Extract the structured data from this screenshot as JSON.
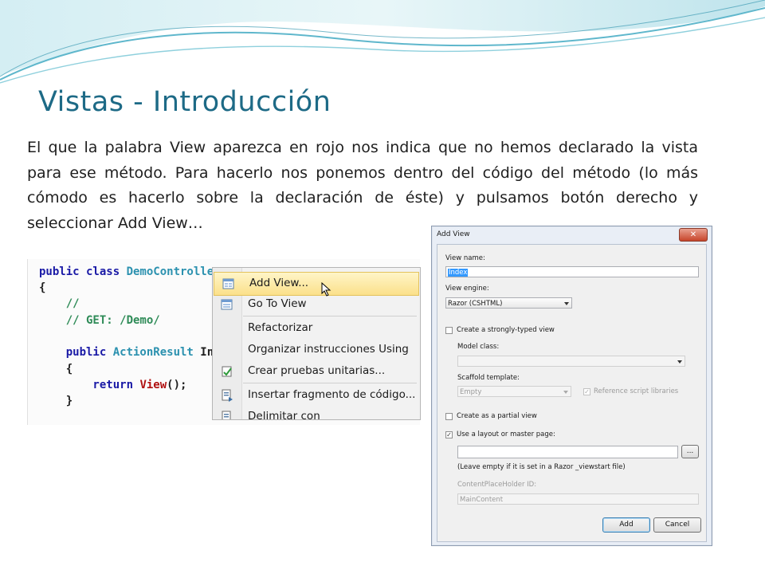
{
  "slide": {
    "title": "Vistas - Introducción",
    "body": "El que la palabra View aparezca en rojo nos indica que no hemos declarado la vista para ese método. Para hacerlo nos ponemos dentro del código del método (lo más cómodo es hacerlo sobre la declaración de éste) y pulsamos botón derecho  y seleccionar Add View…"
  },
  "code": {
    "line1_kw": "public class ",
    "line1_type": "DemoControlle",
    "line2": "{",
    "line3": "    //",
    "line4": "    // GET: /Demo/",
    "line6_kw": "    public ",
    "line6_type": "ActionResult",
    "line6_rest": " In",
    "line7": "    {",
    "line8_kw": "        return ",
    "line8_call": "View",
    "line8_rest": "();",
    "line9": "    }"
  },
  "context_menu": {
    "items": [
      {
        "label": "Add View...",
        "icon": "add-view-icon"
      },
      {
        "label": "Go To View",
        "icon": "go-to-view-icon"
      },
      {
        "label": "Refactorizar",
        "icon": ""
      },
      {
        "label": "Organizar instrucciones Using",
        "icon": ""
      },
      {
        "label": "Crear pruebas unitarias...",
        "icon": "unit-test-icon"
      },
      {
        "label": "Insertar fragmento de código...",
        "icon": "insert-snippet-icon"
      },
      {
        "label": "Delimitar con",
        "icon": "surround-with-icon"
      }
    ]
  },
  "dialog": {
    "title": "Add View",
    "close_glyph": "✕",
    "view_name_label": "View name:",
    "view_name_value": "Index",
    "view_engine_label": "View engine:",
    "view_engine_value": "Razor (CSHTML)",
    "strongly_typed_label": "Create a strongly-typed view",
    "strongly_typed_checked": false,
    "model_class_label": "Model class:",
    "model_class_value": "",
    "scaffold_label": "Scaffold template:",
    "scaffold_value": "Empty",
    "reference_scripts_label": "Reference script libraries",
    "reference_scripts_checked": true,
    "partial_view_label": "Create as a partial view",
    "partial_view_checked": false,
    "use_layout_label": "Use a layout or master page:",
    "use_layout_checked": true,
    "layout_value": "",
    "browse_label": "...",
    "layout_hint": "(Leave empty if it is set in a Razor _viewstart file)",
    "placeholder_id_label": "ContentPlaceHolder ID:",
    "placeholder_id_value": "MainContent",
    "add_label": "Add",
    "cancel_label": "Cancel",
    "check_glyph": "✓"
  },
  "colors": {
    "title": "#1d6a86",
    "keyword": "#1a1aa6",
    "type": "#2b91af",
    "comment": "#2e8b57",
    "menu_highlight": "#fbe08a"
  }
}
